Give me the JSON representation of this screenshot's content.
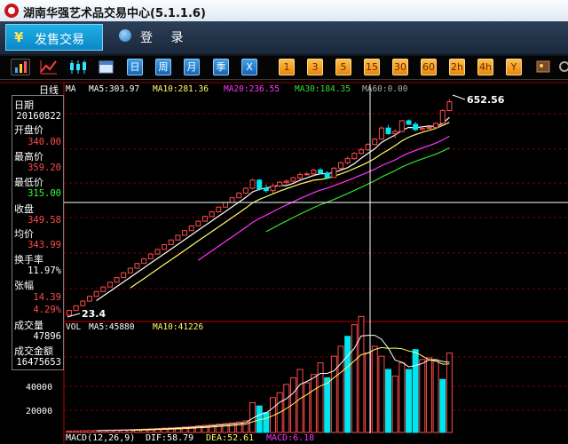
{
  "window": {
    "title": "湖南华强艺术品交易中心(5.1.1.6)"
  },
  "nav": {
    "trade_tab": "发售交易",
    "login": "登 录"
  },
  "toolbar": {
    "period_buttons": [
      "日",
      "周",
      "月",
      "季",
      "X"
    ],
    "interval_buttons": [
      "1",
      "3",
      "5",
      "15",
      "30",
      "60",
      "2h",
      "4h",
      "Y"
    ]
  },
  "chart_header": {
    "period_label": "日线",
    "ma_label": "MA",
    "ma5": "MA5:303.97",
    "ma10": "MA10:281.36",
    "ma20": "MA20:236.55",
    "ma30": "MA30:184.35",
    "ma60": "MA60:0.00"
  },
  "info_panel": {
    "date_label": "日期",
    "date": "20160822",
    "open_label": "开盘价",
    "open": "340.00",
    "high_label": "最高价",
    "high": "359.20",
    "low_label": "最低价",
    "low": "315.00",
    "close_label": "收盘",
    "close": "349.58",
    "avg_label": "均价",
    "avg": "343.99",
    "turnover_label": "换手率",
    "turnover": "11.97%",
    "change_label": "张幅",
    "change_abs": "14.39",
    "change_pct": "4.29%",
    "volume_label": "成交量",
    "volume": "47896",
    "amount_label": "成交金额",
    "amount": "16475653"
  },
  "volume_header": {
    "vol": "VOL",
    "ma5": "MA5:45880",
    "ma10": "MA10:41226"
  },
  "bottom_indicators": {
    "macd": "MACD(12,26,9)",
    "dif": "DIF:58.79",
    "dea": "DEA:52.61",
    "macd_val": "MACD:6.18"
  },
  "colors": {
    "up": "#ff4a4a",
    "down": "#00e5ee",
    "ma5": "#ffffff",
    "ma10": "#ffff66",
    "ma20": "#ff33ff",
    "ma30": "#33dd33"
  },
  "chart_data": {
    "type": "candlestick",
    "price_annotations": {
      "max": "652.56",
      "min": "23.4"
    },
    "y_axis_labels": [
      "40000",
      "20000"
    ],
    "price_range": [
      23.4,
      652.56
    ],
    "candles": [
      {
        "o": 23.4,
        "h": 25.4,
        "l": 23.4,
        "c": 25.2
      },
      {
        "o": 25.2,
        "h": 27.3,
        "l": 25.0,
        "c": 27.1
      },
      {
        "o": 27.1,
        "h": 29.4,
        "l": 27.0,
        "c": 29.1
      },
      {
        "o": 29.1,
        "h": 31.7,
        "l": 29.0,
        "c": 31.3
      },
      {
        "o": 31.3,
        "h": 34.0,
        "l": 31.2,
        "c": 33.7
      },
      {
        "o": 33.7,
        "h": 36.6,
        "l": 33.5,
        "c": 36.2
      },
      {
        "o": 36.2,
        "h": 39.3,
        "l": 36.0,
        "c": 38.9
      },
      {
        "o": 38.9,
        "h": 42.3,
        "l": 38.8,
        "c": 41.8
      },
      {
        "o": 41.8,
        "h": 45.4,
        "l": 41.6,
        "c": 45.0
      },
      {
        "o": 45.0,
        "h": 48.8,
        "l": 44.8,
        "c": 48.3
      },
      {
        "o": 48.3,
        "h": 52.5,
        "l": 48.1,
        "c": 52.0
      },
      {
        "o": 52.0,
        "h": 56.5,
        "l": 51.8,
        "c": 55.9
      },
      {
        "o": 55.9,
        "h": 60.7,
        "l": 55.6,
        "c": 60.1
      },
      {
        "o": 60.1,
        "h": 65.3,
        "l": 59.8,
        "c": 64.6
      },
      {
        "o": 64.6,
        "h": 70.2,
        "l": 64.3,
        "c": 69.5
      },
      {
        "o": 69.5,
        "h": 75.5,
        "l": 69.2,
        "c": 74.7
      },
      {
        "o": 74.7,
        "h": 81.2,
        "l": 74.4,
        "c": 80.3
      },
      {
        "o": 80.3,
        "h": 87.3,
        "l": 80.0,
        "c": 86.3
      },
      {
        "o": 86.3,
        "h": 93.8,
        "l": 86.0,
        "c": 92.8
      },
      {
        "o": 92.8,
        "h": 100.9,
        "l": 92.4,
        "c": 99.8
      },
      {
        "o": 99.8,
        "h": 108.6,
        "l": 99.4,
        "c": 107.3
      },
      {
        "o": 107.3,
        "h": 116.6,
        "l": 106.8,
        "c": 115.3
      },
      {
        "o": 115.3,
        "h": 125.4,
        "l": 114.8,
        "c": 124.0
      },
      {
        "o": 124.0,
        "h": 134.8,
        "l": 123.4,
        "c": 133.3
      },
      {
        "o": 133.3,
        "h": 145.0,
        "l": 132.7,
        "c": 143.3
      },
      {
        "o": 143.3,
        "h": 155.9,
        "l": 142.6,
        "c": 154.0
      },
      {
        "o": 154.0,
        "h": 168.0,
        "l": 152.0,
        "c": 166.0
      },
      {
        "o": 166.0,
        "h": 192.0,
        "l": 163.0,
        "c": 188.0
      },
      {
        "o": 188.0,
        "h": 191.0,
        "l": 160.0,
        "c": 165.0
      },
      {
        "o": 165.0,
        "h": 176.0,
        "l": 155.0,
        "c": 160.0
      },
      {
        "o": 160.0,
        "h": 178.0,
        "l": 154.0,
        "c": 172.0
      },
      {
        "o": 172.0,
        "h": 185.0,
        "l": 168.0,
        "c": 182.0
      },
      {
        "o": 182.0,
        "h": 190.0,
        "l": 176.0,
        "c": 185.0
      },
      {
        "o": 185.0,
        "h": 198.0,
        "l": 180.0,
        "c": 195.0
      },
      {
        "o": 195.0,
        "h": 212.0,
        "l": 190.0,
        "c": 205.0
      },
      {
        "o": 205.0,
        "h": 214.0,
        "l": 203.0,
        "c": 207.0
      },
      {
        "o": 207.0,
        "h": 224.0,
        "l": 198.0,
        "c": 220.0
      },
      {
        "o": 220.0,
        "h": 226.0,
        "l": 205.0,
        "c": 210.0
      },
      {
        "o": 210.0,
        "h": 216.0,
        "l": 192.0,
        "c": 196.0
      },
      {
        "o": 196.0,
        "h": 230.0,
        "l": 194.0,
        "c": 226.0
      },
      {
        "o": 226.0,
        "h": 250.0,
        "l": 222.0,
        "c": 246.0
      },
      {
        "o": 246.0,
        "h": 270.0,
        "l": 240.0,
        "c": 262.0
      },
      {
        "o": 262.0,
        "h": 290.0,
        "l": 258.0,
        "c": 284.0
      },
      {
        "o": 284.0,
        "h": 310.0,
        "l": 278.0,
        "c": 300.0
      },
      {
        "o": 300.0,
        "h": 332.0,
        "l": 296.0,
        "c": 326.0
      },
      {
        "o": 326.0,
        "h": 360.0,
        "l": 322.0,
        "c": 354.0
      },
      {
        "o": 354.0,
        "h": 430.0,
        "l": 350.0,
        "c": 420.0
      },
      {
        "o": 420.0,
        "h": 440.0,
        "l": 380.0,
        "c": 385.0
      },
      {
        "o": 385.0,
        "h": 412.0,
        "l": 360.0,
        "c": 398.0
      },
      {
        "o": 398.0,
        "h": 475.0,
        "l": 392.0,
        "c": 470.0
      },
      {
        "o": 470.0,
        "h": 478.0,
        "l": 440.0,
        "c": 445.0
      },
      {
        "o": 445.0,
        "h": 462.0,
        "l": 400.0,
        "c": 410.0
      },
      {
        "o": 410.0,
        "h": 432.0,
        "l": 402.0,
        "c": 418.0
      },
      {
        "o": 418.0,
        "h": 428.0,
        "l": 405.0,
        "c": 424.0
      },
      {
        "o": 424.0,
        "h": 458.0,
        "l": 415.0,
        "c": 452.0
      },
      {
        "o": 452.0,
        "h": 560.0,
        "l": 448.0,
        "c": 550.0
      },
      {
        "o": 550.0,
        "h": 652.56,
        "l": 545.0,
        "c": 630.0
      }
    ],
    "volume_ylim": [
      0,
      60000
    ],
    "volume": [
      800,
      900,
      1000,
      1100,
      1200,
      1300,
      1400,
      1500,
      1600,
      1700,
      1800,
      2000,
      2200,
      2400,
      2600,
      2800,
      3000,
      3300,
      3600,
      4000,
      4300,
      4700,
      5000,
      5400,
      5800,
      6300,
      7000,
      18000,
      16000,
      12000,
      21000,
      24000,
      29000,
      33000,
      38000,
      30000,
      35000,
      42000,
      33000,
      46000,
      52000,
      58000,
      65000,
      70000,
      48000,
      52000,
      46000,
      38000,
      34000,
      42000,
      38000,
      50000,
      44000,
      45000,
      43000,
      32000,
      47896
    ],
    "volume_dir": [
      "up",
      "up",
      "up",
      "up",
      "up",
      "up",
      "up",
      "up",
      "up",
      "up",
      "up",
      "up",
      "up",
      "up",
      "up",
      "up",
      "up",
      "up",
      "up",
      "up",
      "up",
      "up",
      "up",
      "up",
      "up",
      "up",
      "up",
      "up",
      "down",
      "down",
      "up",
      "up",
      "up",
      "up",
      "up",
      "up",
      "up",
      "up",
      "down",
      "up",
      "up",
      "down",
      "up",
      "up",
      "up",
      "up",
      "up",
      "down",
      "up",
      "up",
      "down",
      "down",
      "up",
      "up",
      "up",
      "down",
      "up"
    ]
  }
}
